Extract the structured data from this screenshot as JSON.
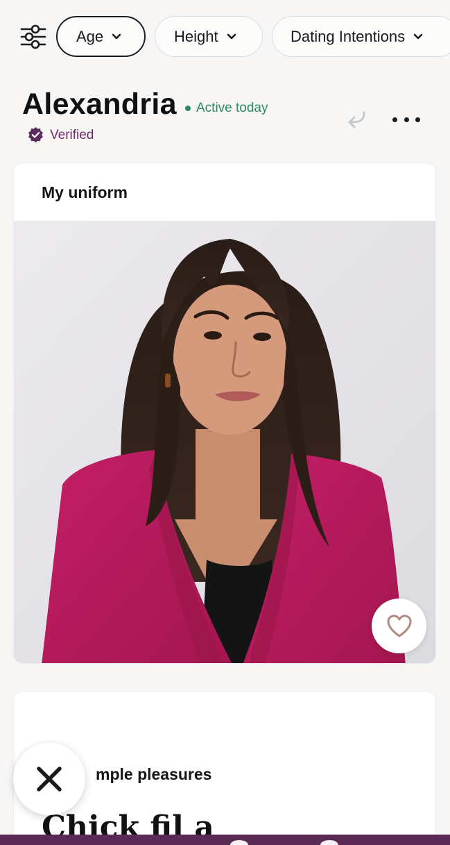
{
  "filters": {
    "chips": [
      {
        "label": "Age",
        "selected": true
      },
      {
        "label": "Height",
        "selected": false
      },
      {
        "label": "Dating Intentions",
        "selected": false
      }
    ]
  },
  "profile": {
    "name": "Alexandria",
    "status": "Active today",
    "verified_label": "Verified"
  },
  "prompt_card": {
    "title": "My uniform"
  },
  "second_card": {
    "prompt_visible": "mple pleasures",
    "answer_visible": "Chick fil a"
  },
  "colors": {
    "active_green": "#2e8a62",
    "verified_purple": "#6b2d6b",
    "bottom_bar": "#5a2a55",
    "heart_stroke": "#b08a7e"
  },
  "icons": {
    "filter": "sliders-icon",
    "undo": "undo-arrow-icon",
    "more": "more-dots-icon",
    "like": "heart-outline-icon",
    "skip": "x-icon",
    "verified": "verified-badge-icon"
  }
}
